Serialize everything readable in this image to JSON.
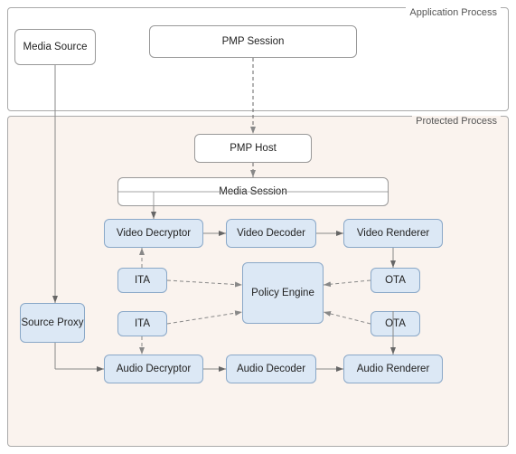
{
  "labels": {
    "appProcess": "Application Process",
    "protectedProcess": "Protected Process",
    "mediaSource": "Media Source",
    "pmpSession": "PMP Session",
    "pmpHost": "PMP Host",
    "mediaSession": "Media Session",
    "videoDecryptor": "Video Decryptor",
    "videoDecoder": "Video Decoder",
    "videoRenderer": "Video Renderer",
    "audioDecryptor": "Audio Decryptor",
    "audioDecoder": "Audio Decoder",
    "audioRenderer": "Audio Renderer",
    "sourceProxy": "Source Proxy",
    "policyEngine": "Policy Engine",
    "ita1": "ITA",
    "ita2": "ITA",
    "ota1": "OTA",
    "ota2": "OTA"
  }
}
